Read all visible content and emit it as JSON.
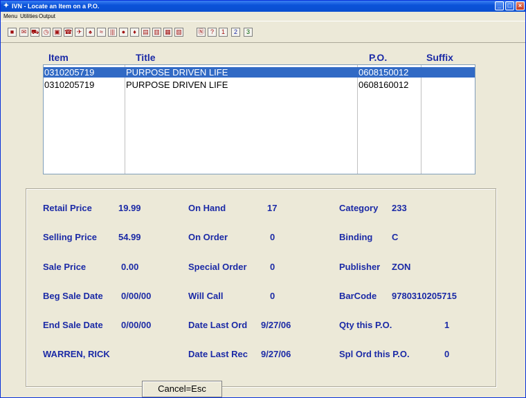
{
  "window": {
    "title": "IVN - Locate an Item on a P.O.",
    "min": "_",
    "max": "□",
    "close": "×"
  },
  "menu": [
    "Menu",
    "Utilities",
    "Output"
  ],
  "toolbar": [
    "■",
    "✉",
    "⛟",
    "◷",
    "▣",
    "☎",
    "✈",
    "♠",
    "≈",
    "|||",
    "●",
    "♦",
    "▤",
    "▥",
    "▦",
    "▧",
    "Ⓝ",
    "?",
    "1",
    "2",
    "3"
  ],
  "list": {
    "headers": {
      "item": "Item",
      "title": "Title",
      "po": "P.O.",
      "suffix": "Suffix"
    },
    "rows": [
      {
        "item": "0310205719",
        "title": "PURPOSE DRIVEN LIFE",
        "po": "0608150012",
        "suffix": ""
      },
      {
        "item": "0310205719",
        "title": "PURPOSE DRIVEN LIFE",
        "po": "0608160012",
        "suffix": ""
      }
    ]
  },
  "details": {
    "retail_price_label": "Retail Price",
    "retail_price": "19.99",
    "selling_price_label": "Selling Price",
    "selling_price": "54.99",
    "sale_price_label": "Sale Price",
    "sale_price": "0.00",
    "beg_sale_date_label": "Beg Sale Date",
    "beg_sale_date": "0/00/00",
    "end_sale_date_label": "End Sale Date",
    "end_sale_date": "0/00/00",
    "author": "WARREN, RICK",
    "on_hand_label": "On Hand",
    "on_hand": "17",
    "on_order_label": "On Order",
    "on_order": "0",
    "special_order_label": "Special Order",
    "special_order": "0",
    "will_call_label": "Will Call",
    "will_call": "0",
    "date_last_ord_label": "Date Last Ord",
    "date_last_ord": "9/27/06",
    "date_last_rec_label": "Date Last Rec",
    "date_last_rec": "9/27/06",
    "category_label": "Category",
    "category": "233",
    "binding_label": "Binding",
    "binding": "C",
    "publisher_label": "Publisher",
    "publisher": "ZON",
    "barcode_label": "BarCode",
    "barcode": "9780310205715",
    "qty_po_label": "Qty this P.O.",
    "qty_po": "1",
    "spl_ord_po_label": "Spl Ord this P.O.",
    "spl_ord_po": "0"
  },
  "cancel_button": "Cancel=Esc"
}
